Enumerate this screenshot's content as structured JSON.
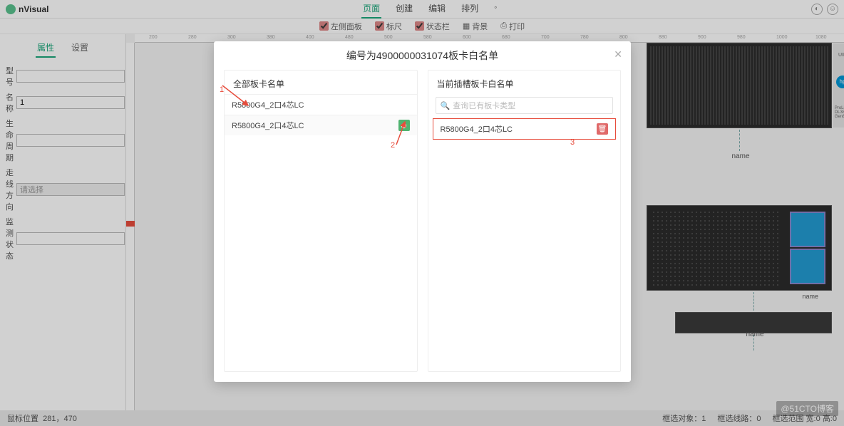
{
  "app": {
    "name": "nVisual"
  },
  "topmenu": {
    "page": "页面",
    "create": "创建",
    "edit": "编辑",
    "arrange": "排列",
    "dropdown": "◦"
  },
  "toolbar": {
    "leftpanel": "左侧面板",
    "ruler": "标尺",
    "statusbar": "状态栏",
    "wallpaper": "背景",
    "print": "打印"
  },
  "lefttabs": {
    "properties": "属性",
    "settings": "设置"
  },
  "props": {
    "model_label": "型号",
    "model_value": "",
    "name_label": "名称",
    "name_value": "1",
    "life_label": "生命周期",
    "life_value": "",
    "wiring_label": "走线方向",
    "wiring_value": "请选择",
    "monitor_label": "监测状态",
    "monitor_value": ""
  },
  "modal": {
    "title": "编号为4900000031074板卡白名单",
    "left_title": "全部板卡名单",
    "right_title": "当前插槽板卡白名单",
    "search_placeholder": "查询已有板卡类型",
    "items_left": [
      {
        "label": "R5800G4_2口4芯LC"
      },
      {
        "label": "R5800G4_2口4芯LC"
      }
    ],
    "items_right": [
      {
        "label": "R5800G4_2口4芯LC"
      }
    ]
  },
  "annotations": {
    "a1": "1",
    "a2": "2",
    "a3": "3"
  },
  "canvas": {
    "name_label": "name",
    "ruler_marks": [
      "200",
      "280",
      "300",
      "380",
      "400",
      "480",
      "500",
      "580",
      "600",
      "680",
      "700",
      "780",
      "800",
      "880",
      "900",
      "980",
      "1000",
      "1080"
    ]
  },
  "status": {
    "mouse_label": "鼠标位置",
    "mouse_value": "281，470",
    "sel_obj_label": "框选对象：",
    "sel_obj_value": "1",
    "sel_line_label": "框选线路：",
    "sel_line_value": "0",
    "sel_range_label": "框选范围 宽:",
    "sel_range_w": "0",
    "sel_range_h_label": "高:",
    "sel_range_h": "0"
  },
  "watermark": "@51CTO博客"
}
